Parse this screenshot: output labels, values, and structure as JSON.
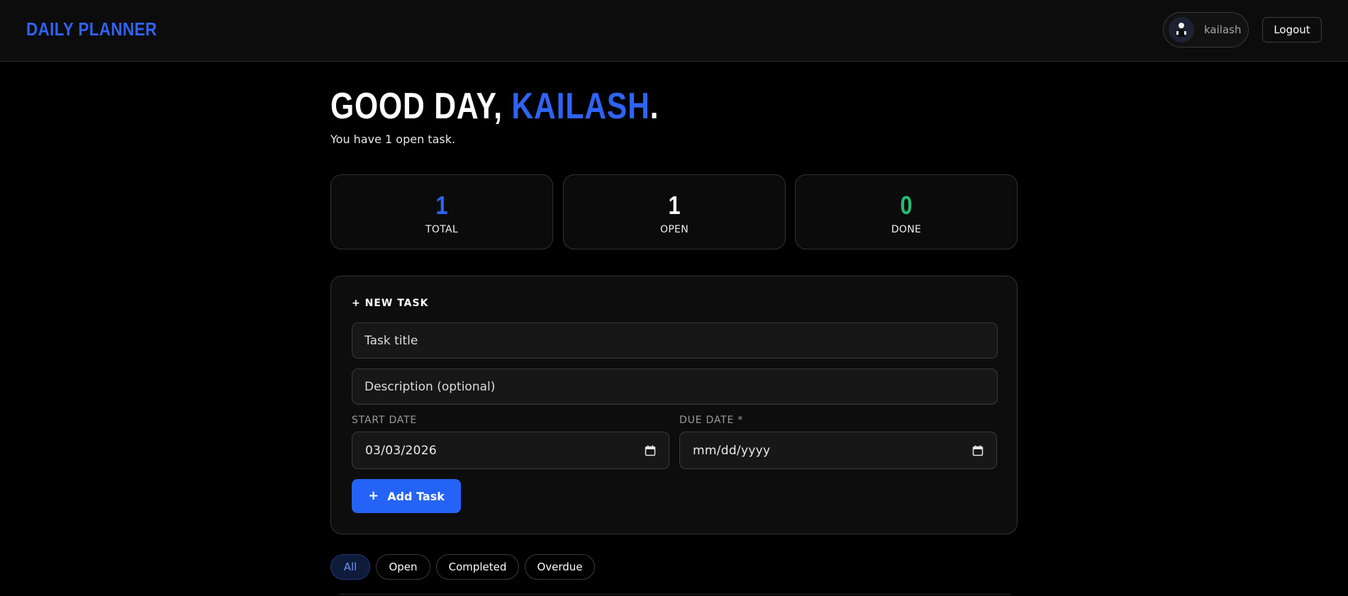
{
  "header": {
    "brand": "DAILY PLANNER",
    "user_name": "kailash",
    "logout_label": "Logout"
  },
  "greeting": {
    "prefix": "GOOD DAY, ",
    "name": "KAILASH",
    "suffix": ".",
    "subtitle": "You have 1 open task."
  },
  "stats": [
    {
      "value": "1",
      "label": "TOTAL",
      "color": "#2f63f3"
    },
    {
      "value": "1",
      "label": "OPEN",
      "color": "#ffffff"
    },
    {
      "value": "0",
      "label": "DONE",
      "color": "#1fbf74"
    }
  ],
  "new_task": {
    "title": "+ NEW TASK",
    "title_placeholder": "Task title",
    "description_placeholder": "Description (optional)",
    "start_label": "START DATE",
    "start_value": "03/03/2026",
    "due_label": "DUE DATE *",
    "due_value": "mm/dd/yyyy",
    "add_icon": "+",
    "add_label": "Add Task"
  },
  "filters": [
    {
      "label": "All",
      "active": true
    },
    {
      "label": "Open",
      "active": false
    },
    {
      "label": "Completed",
      "active": false
    },
    {
      "label": "Overdue",
      "active": false
    }
  ],
  "icons": {
    "avatar": "avatar-icon",
    "calendar": "calendar-icon"
  },
  "colors": {
    "accent": "#2463f5",
    "done": "#1fbf74"
  }
}
